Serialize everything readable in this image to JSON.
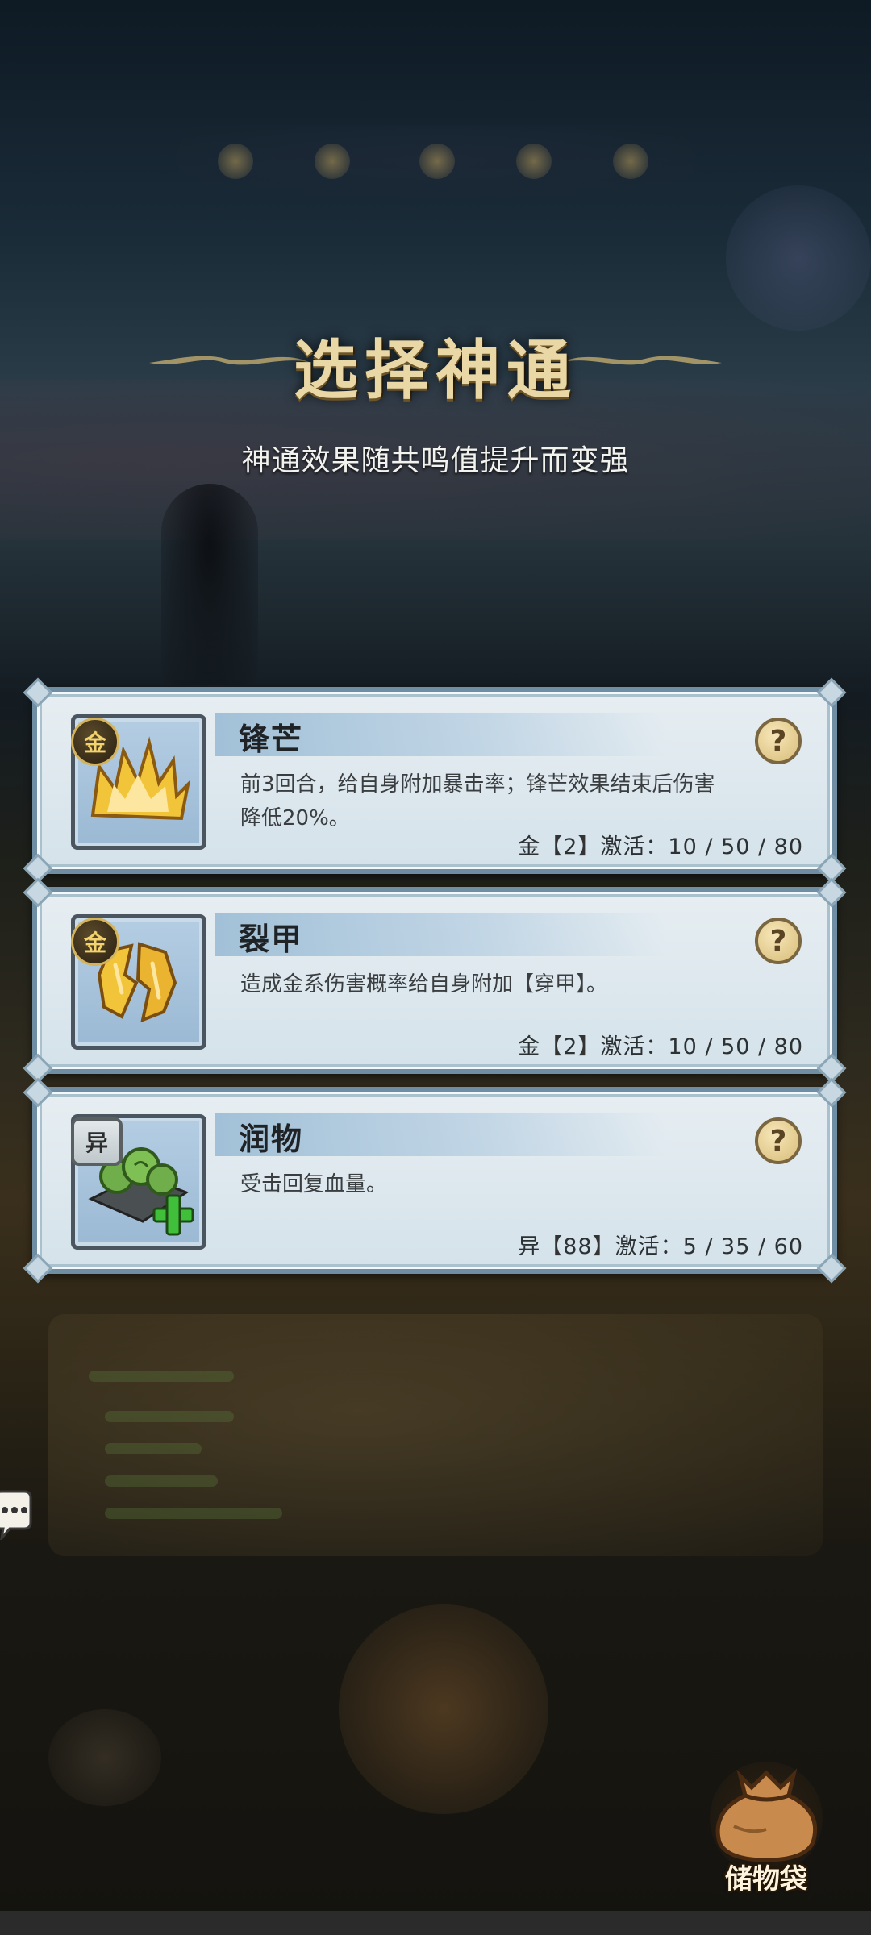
{
  "title": "选择神通",
  "subtitle": "神通效果随共鸣值提升而变强",
  "cards": [
    {
      "badge": "金",
      "badge_style": "round",
      "name": "锋芒",
      "description": "前3回合，给自身附加暴击率；锋芒效果结束后伤害降低20%。",
      "element": "金",
      "resonance": "2",
      "activate_label": "激活",
      "thresholds": "10 / 50 / 80",
      "help": "?",
      "icon": "golden-crown-spikes-icon"
    },
    {
      "badge": "金",
      "badge_style": "round",
      "name": "裂甲",
      "description": "造成金系伤害概率给自身附加【穿甲】。",
      "element": "金",
      "resonance": "2",
      "activate_label": "激活",
      "thresholds": "10 / 50 / 80",
      "help": "?",
      "icon": "broken-golden-shield-icon"
    },
    {
      "badge": "异",
      "badge_style": "square",
      "name": "润物",
      "description": "受击回复血量。",
      "element": "异",
      "resonance": "88",
      "activate_label": "激活",
      "thresholds": "5 / 35 / 60",
      "help": "?",
      "icon": "healing-herbs-icon"
    }
  ],
  "storage_bag": {
    "label": "储物袋",
    "icon": "cloth-bag-icon"
  },
  "colors": {
    "card_border": "#6f8ea3",
    "title_gold": "#e9d7a6",
    "badge_gold": "#f3d36d",
    "heal_green": "#3fbf3a"
  }
}
